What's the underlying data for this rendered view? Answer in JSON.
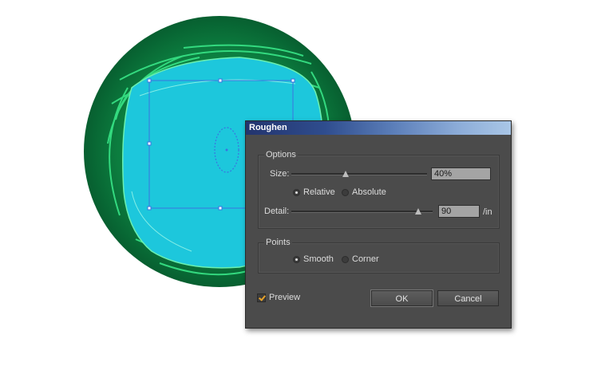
{
  "dialog": {
    "title": "Roughen",
    "options": {
      "group_label": "Options",
      "size_label": "Size:",
      "size_value": "40%",
      "size_fraction": 0.4,
      "relative_label": "Relative",
      "absolute_label": "Absolute",
      "selected_mode": "Relative",
      "detail_label": "Detail:",
      "detail_value": "90",
      "detail_unit": "/in",
      "detail_fraction": 0.9
    },
    "points": {
      "group_label": "Points",
      "smooth_label": "Smooth",
      "corner_label": "Corner",
      "selected": "Smooth"
    },
    "preview_label": "Preview",
    "preview_checked": true,
    "ok_label": "OK",
    "cancel_label": "Cancel"
  },
  "colors": {
    "dialog_bg": "#4b4b4b",
    "circle_outer": "#0a6e38",
    "circle_inner": "#1dc7dc",
    "strokes": "#2ee07a",
    "selection": "#3a73e0",
    "preview_check": "#e8a32a"
  }
}
